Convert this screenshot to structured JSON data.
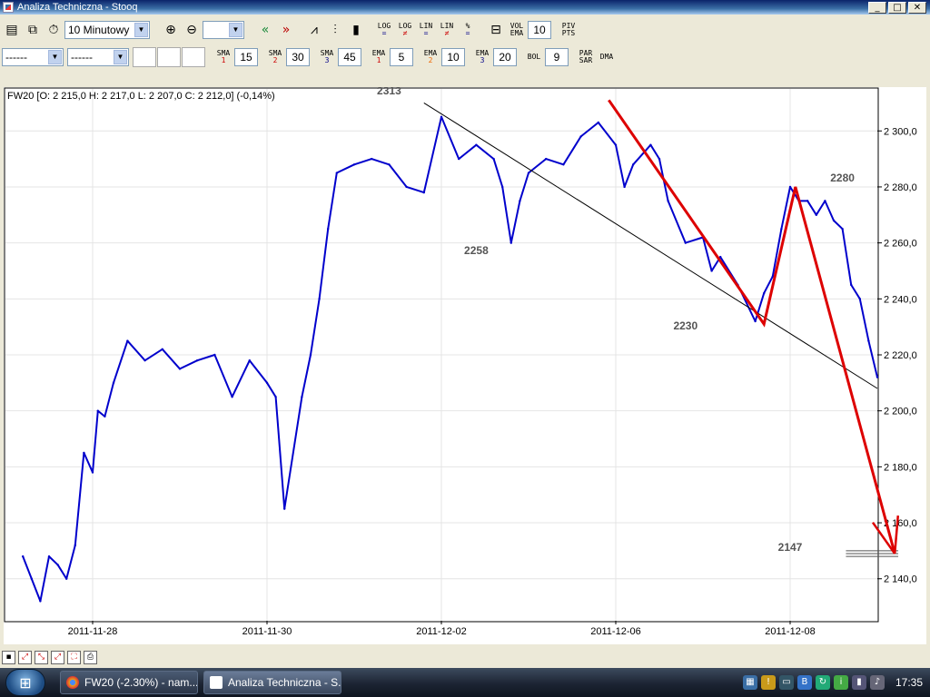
{
  "window": {
    "title": "Analiza Techniczna - Stooq",
    "buttons": {
      "minimize": "_",
      "maximize": "□",
      "close": "✕"
    }
  },
  "toolbar1": {
    "interval": "10 Minutowy",
    "zoom_level": "",
    "log1": {
      "top": "LOG",
      "bottom": "="
    },
    "log2": {
      "top": "LOG",
      "bottom": "≠"
    },
    "lin1": {
      "top": "LIN",
      "bottom": "="
    },
    "lin2": {
      "top": "LIN",
      "bottom": "≠"
    },
    "pct": {
      "top": "%",
      "bottom": "="
    },
    "vol": {
      "top": "VOL",
      "bottom": "EMA"
    },
    "vol_value": "10",
    "piv": {
      "top": "PIV",
      "bottom": "PTS"
    }
  },
  "toolbar2": {
    "select1": "------",
    "select2": "------",
    "sma1": {
      "label": "SMA",
      "sub": "1",
      "value": "15"
    },
    "sma2": {
      "label": "SMA",
      "sub": "2",
      "value": "30"
    },
    "sma3": {
      "label": "SMA",
      "sub": "3",
      "value": "45"
    },
    "ema1": {
      "label": "EMA",
      "sub": "1",
      "value": "5"
    },
    "ema2": {
      "label": "EMA",
      "sub": "2",
      "value": "10"
    },
    "ema3": {
      "label": "EMA",
      "sub": "3",
      "value": "20"
    },
    "bol": {
      "label": "BOL",
      "value": "9"
    },
    "par": {
      "top": "PAR",
      "bottom": "SAR"
    },
    "dma": "DMA"
  },
  "chart_header": "FW20 [O: 2 215,0  H: 2 217,0  L: 2 207,0  C: 2 212,0] (-0,14%)",
  "chart_data": {
    "type": "line",
    "symbol": "FW20",
    "ohlc": {
      "open": 2215.0,
      "high": 2217.0,
      "low": 2207.0,
      "close": 2212.0,
      "change_pct": -0.14
    },
    "ylim": [
      2125,
      2315
    ],
    "yticks": [
      2140,
      2160,
      2180,
      2200,
      2220,
      2240,
      2260,
      2280,
      2300
    ],
    "ytick_labels": [
      "2 140,0",
      "2 160,0",
      "2 180,0",
      "2 200,0",
      "2 220,0",
      "2 240,0",
      "2 260,0",
      "2 280,0",
      "2 300,0"
    ],
    "xlim": [
      0,
      50
    ],
    "xticks": [
      5,
      15,
      25,
      35,
      45
    ],
    "xtick_labels": [
      "2011-11-28",
      "2011-11-30",
      "2011-12-02",
      "2011-12-06",
      "2011-12-08"
    ],
    "grid": true,
    "series": [
      {
        "color": "#0000cc",
        "x": [
          1,
          1.5,
          2,
          2.5,
          3,
          3.5,
          4,
          4.5,
          5,
          5.3,
          5.7,
          6.2,
          7,
          8,
          9,
          10,
          11,
          12,
          13,
          14,
          15,
          15.5,
          16,
          17,
          17.5,
          18,
          18.5,
          19,
          20,
          21,
          22,
          23,
          24,
          25,
          26,
          27,
          28,
          28.5,
          29,
          29.5,
          30,
          31,
          32,
          33,
          34,
          35,
          35.5,
          36,
          37,
          37.5,
          38,
          39,
          40,
          40.5,
          41,
          42,
          43,
          43.5,
          44,
          44.5,
          45,
          45.5,
          46,
          46.5,
          47,
          47.5,
          48,
          48.5,
          49,
          49.5,
          50
        ],
        "y": [
          2148,
          2140,
          2132,
          2148,
          2145,
          2140,
          2152,
          2185,
          2178,
          2200,
          2198,
          2210,
          2225,
          2218,
          2222,
          2215,
          2218,
          2220,
          2205,
          2218,
          2210,
          2205,
          2165,
          2205,
          2220,
          2240,
          2265,
          2285,
          2288,
          2290,
          2288,
          2280,
          2278,
          2305,
          2290,
          2295,
          2290,
          2280,
          2260,
          2275,
          2285,
          2290,
          2288,
          2298,
          2303,
          2295,
          2280,
          2288,
          2295,
          2290,
          2275,
          2260,
          2262,
          2250,
          2255,
          2245,
          2232,
          2242,
          2248,
          2265,
          2280,
          2275,
          2275,
          2270,
          2275,
          2268,
          2265,
          2245,
          2240,
          2225,
          2212
        ]
      }
    ],
    "trendlines": [
      {
        "color": "#000000",
        "points": [
          [
            24,
            2310
          ],
          [
            50,
            2208
          ]
        ]
      },
      {
        "color": "#dd0000",
        "points": [
          [
            34.6,
            2311
          ],
          [
            43.5,
            2231
          ],
          [
            45.3,
            2280
          ],
          [
            51,
            2149
          ]
        ]
      }
    ],
    "horizontal_lines": [
      {
        "color": "#555555",
        "y": 2148
      },
      {
        "color": "#555555",
        "y": 2149
      },
      {
        "color": "#555555",
        "y": 2150
      }
    ],
    "annotations": [
      {
        "text": "2313",
        "x": 22,
        "y": 2313
      },
      {
        "text": "2258",
        "x": 27,
        "y": 2256
      },
      {
        "text": "2230",
        "x": 39,
        "y": 2229
      },
      {
        "text": "2280",
        "x": 48,
        "y": 2282
      },
      {
        "text": "2147",
        "x": 45,
        "y": 2150
      }
    ]
  },
  "bottom_icons": [
    "save-icon",
    "fit-icon",
    "shrink-icon",
    "expand-icon",
    "fullscreen-icon",
    "print-icon"
  ],
  "taskbar": {
    "tasks": [
      {
        "label": "FW20 (-2.30%) - nam...",
        "color": "#e8a319"
      },
      {
        "label": "Analiza Techniczna - S...",
        "color": "#c33"
      }
    ],
    "clock": "17:35"
  }
}
